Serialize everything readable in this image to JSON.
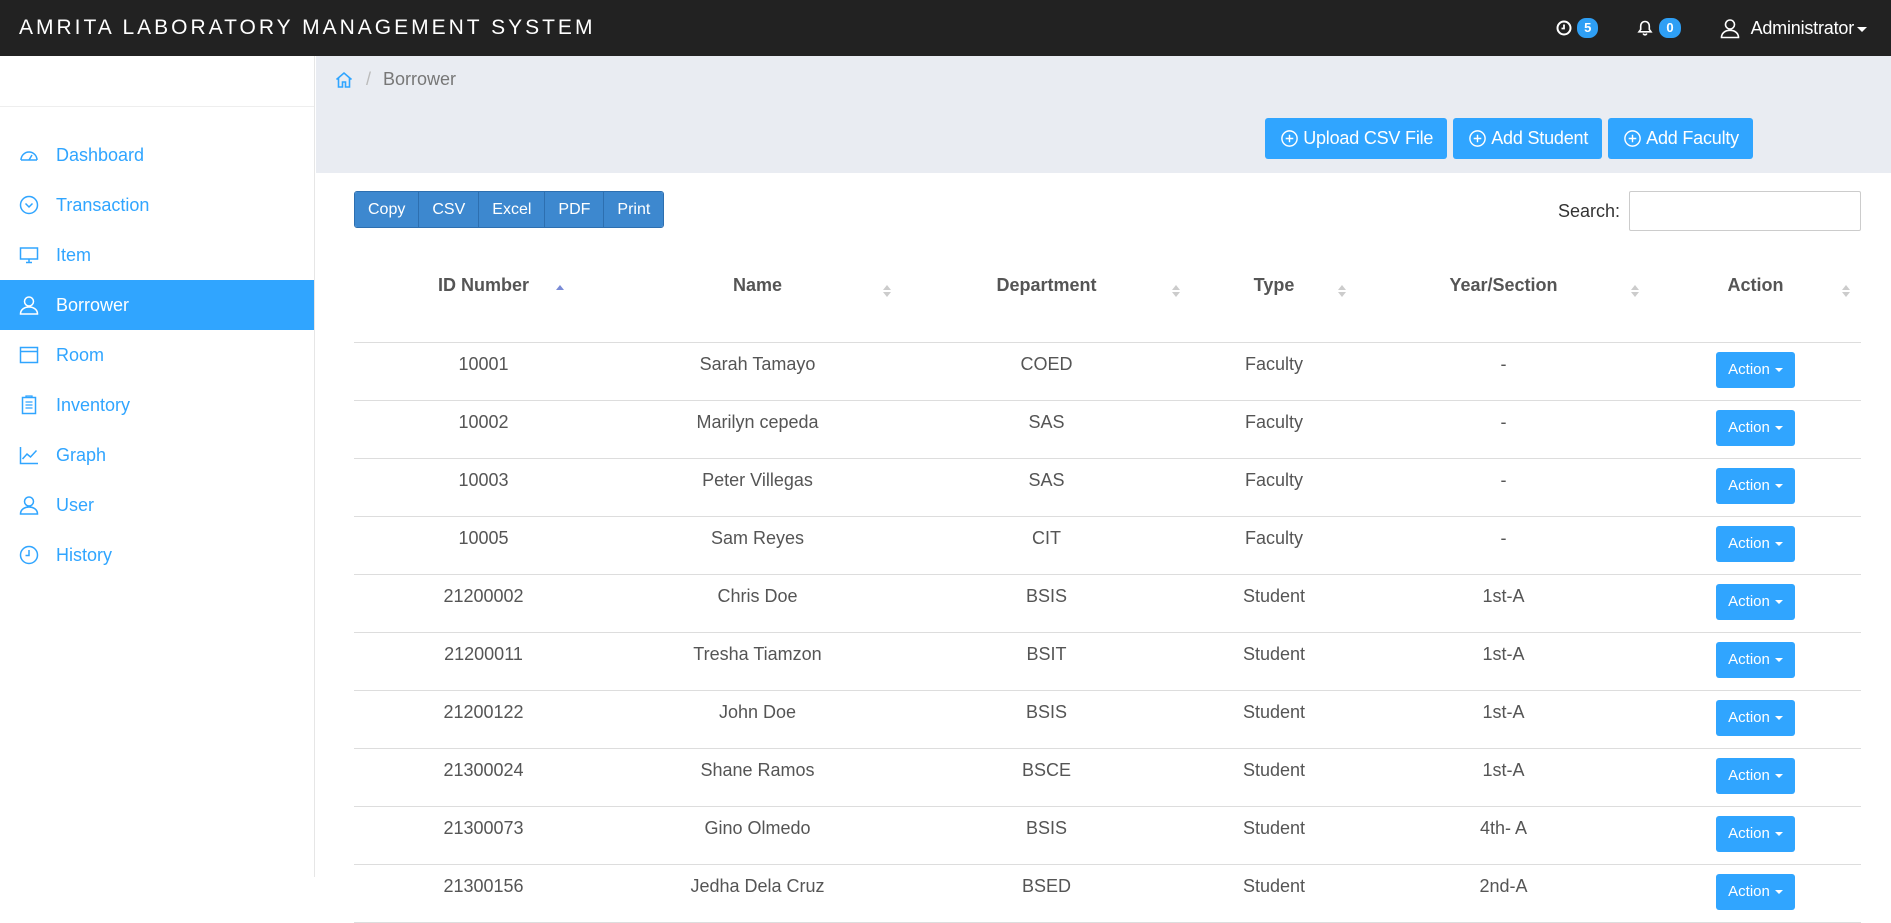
{
  "app": {
    "title": "AMRITA LABORATORY MANAGEMENT SYSTEM",
    "clock_badge": "5",
    "bell_badge": "0",
    "user_name": "Administrator"
  },
  "sidebar": {
    "items": [
      {
        "label": "Dashboard",
        "icon": "dashboard-icon",
        "active": false
      },
      {
        "label": "Transaction",
        "icon": "chevron-circle-icon",
        "active": false
      },
      {
        "label": "Item",
        "icon": "monitor-icon",
        "active": false
      },
      {
        "label": "Borrower",
        "icon": "user-icon",
        "active": true
      },
      {
        "label": "Room",
        "icon": "window-icon",
        "active": false
      },
      {
        "label": "Inventory",
        "icon": "clipboard-icon",
        "active": false
      },
      {
        "label": "Graph",
        "icon": "line-chart-icon",
        "active": false
      },
      {
        "label": "User",
        "icon": "user-icon",
        "active": false
      },
      {
        "label": "History",
        "icon": "clock-icon",
        "active": false
      }
    ]
  },
  "breadcrumb": {
    "current": "Borrower"
  },
  "actions": {
    "upload": "Upload CSV File",
    "add_student": "Add Student",
    "add_faculty": "Add Faculty"
  },
  "toolbar": {
    "copy": "Copy",
    "csv": "CSV",
    "excel": "Excel",
    "pdf": "PDF",
    "print": "Print",
    "search_label": "Search:",
    "search_value": ""
  },
  "table": {
    "columns": [
      "ID Number",
      "Name",
      "Department",
      "Type",
      "Year/Section",
      "Action"
    ],
    "sorted_column": "ID Number",
    "sort_direction": "ascending",
    "rows": [
      {
        "id": "10001",
        "name": "Sarah Tamayo",
        "department": "COED",
        "type": "Faculty",
        "year_section": "-",
        "action": "Action"
      },
      {
        "id": "10002",
        "name": "Marilyn cepeda",
        "department": "SAS",
        "type": "Faculty",
        "year_section": "-",
        "action": "Action"
      },
      {
        "id": "10003",
        "name": "Peter Villegas",
        "department": "SAS",
        "type": "Faculty",
        "year_section": "-",
        "action": "Action"
      },
      {
        "id": "10005",
        "name": "Sam Reyes",
        "department": "CIT",
        "type": "Faculty",
        "year_section": "-",
        "action": "Action"
      },
      {
        "id": "21200002",
        "name": "Chris Doe",
        "department": "BSIS",
        "type": "Student",
        "year_section": "1st-A",
        "action": "Action"
      },
      {
        "id": "21200011",
        "name": "Tresha Tiamzon",
        "department": "BSIT",
        "type": "Student",
        "year_section": "1st-A",
        "action": "Action"
      },
      {
        "id": "21200122",
        "name": "John Doe",
        "department": "BSIS",
        "type": "Student",
        "year_section": "1st-A",
        "action": "Action"
      },
      {
        "id": "21300024",
        "name": "Shane Ramos",
        "department": "BSCE",
        "type": "Student",
        "year_section": "1st-A",
        "action": "Action"
      },
      {
        "id": "21300073",
        "name": "Gino Olmedo",
        "department": "BSIS",
        "type": "Student",
        "year_section": "4th- A",
        "action": "Action"
      },
      {
        "id": "21300156",
        "name": "Jedha Dela Cruz",
        "department": "BSED",
        "type": "Student",
        "year_section": "2nd-A",
        "action": "Action"
      }
    ]
  },
  "colors": {
    "navbar": "#222222",
    "accent": "#30a5ff",
    "export_buttons": "#3d88cf",
    "header_band": "#e9ecf2"
  }
}
